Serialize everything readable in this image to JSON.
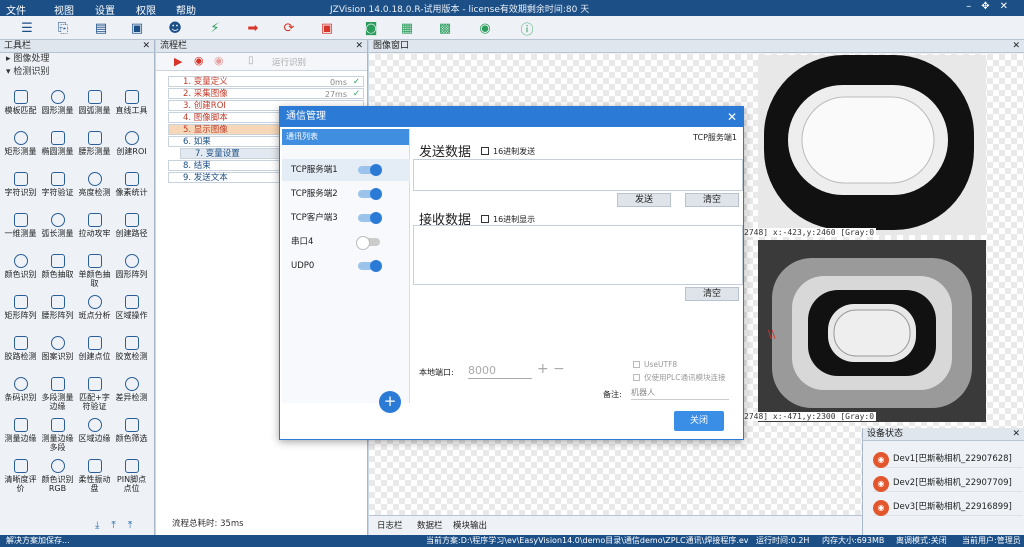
{
  "menu": {
    "file": "文件",
    "view": "视图",
    "settings": "设置",
    "permission": "权限",
    "help": "帮助"
  },
  "title": "JZVision 14.0.18.0.R-试用版本 - license有效期剩余时间:80 天",
  "toolbox": {
    "header": "工具栏",
    "sec_image": "图像处理",
    "sec_detect": "检测识别",
    "tools": [
      "模板匹配",
      "圆形测量",
      "圆弧测量",
      "直线工具",
      "矩形测量",
      "椭圆测量",
      "腰形测量",
      "创建ROI",
      "字符识别",
      "字符验证",
      "亮度检测",
      "像素统计",
      "一维测量",
      "弧长测量",
      "拉动攻牢",
      "创建路径",
      "颜色识别",
      "颜色抽取",
      "单颜色抽取",
      "圆形阵列",
      "矩形阵列",
      "腰形阵列",
      "斑点分析",
      "区域操作",
      "胶路检测",
      "图案识别",
      "创建点位",
      "胶宽检测",
      "条码识别",
      "多段测量边缘",
      "匹配+字符验证",
      "差异检测",
      "测量边缘",
      "测量边缘多段",
      "区域边缘",
      "颜色筛选",
      "清晰度评价",
      "颜色识别RGB",
      "柔性振动盘",
      "PIN脚点点位"
    ]
  },
  "flow": {
    "header": "流程栏",
    "run_once": "运行识别",
    "items": [
      {
        "label": "1. 变量定义",
        "time": "0ms"
      },
      {
        "label": "2. 采集图像",
        "time": "27ms"
      },
      {
        "label": "3. 创建ROI"
      },
      {
        "label": "4. 图像脚本"
      },
      {
        "label": "5. 显示图像"
      },
      {
        "label": "6. 如果"
      },
      {
        "label": "7. 变量设置"
      },
      {
        "label": "8. 结束"
      },
      {
        "label": "9. 发送文本"
      }
    ],
    "total": "流程总耗时: 35ms"
  },
  "image": {
    "header": "图像窗口",
    "coord1": "2748] x:-423,y:2460 [Gray:0",
    "coord2": "2748] x:-471,y:2300 [Gray:0"
  },
  "devices": {
    "header": "设备状态",
    "items": [
      "Dev1[巴斯勒相机_22907628]",
      "Dev2[巴斯勒相机_22907709]",
      "Dev3[巴斯勒相机_22916899]"
    ]
  },
  "logtabs": [
    "日志栏",
    "数据栏",
    "模块输出"
  ],
  "status": {
    "left": "解决方案加保存...",
    "path": "当前方案:D:\\程序学习\\ev\\EasyVision14.0\\demo目录\\通信demo\\ZPLC通讯\\焊接程序.ev",
    "runtime": "运行时间:0.2H",
    "mem": "内存大小:693MB",
    "mode": "离调模式:关闭",
    "user": "当前用户:管理员"
  },
  "dialog": {
    "title": "通信管理",
    "list_header": "通讯列表",
    "conn_name": "TCP服务端1",
    "conns": [
      {
        "label": "TCP服务端1",
        "on": true
      },
      {
        "label": "TCP服务端2",
        "on": true
      },
      {
        "label": "TCP客户端3",
        "on": true
      },
      {
        "label": "串口4",
        "on": false
      },
      {
        "label": "UDP0",
        "on": true
      }
    ],
    "send_title": "发送数据",
    "send_hex": "16进制发送",
    "send_btn": "发送",
    "clear_btn": "清空",
    "recv_title": "接收数据",
    "recv_hex": "16进制显示",
    "clear_btn2": "清空",
    "port_label": "本地端口:",
    "port_value": "8000",
    "use_utf8": "UseUTF8",
    "plc_only": "仅使用PLC通讯模块连接",
    "remark_label": "备注:",
    "remark_value": "机器人",
    "close_btn": "关闭"
  }
}
